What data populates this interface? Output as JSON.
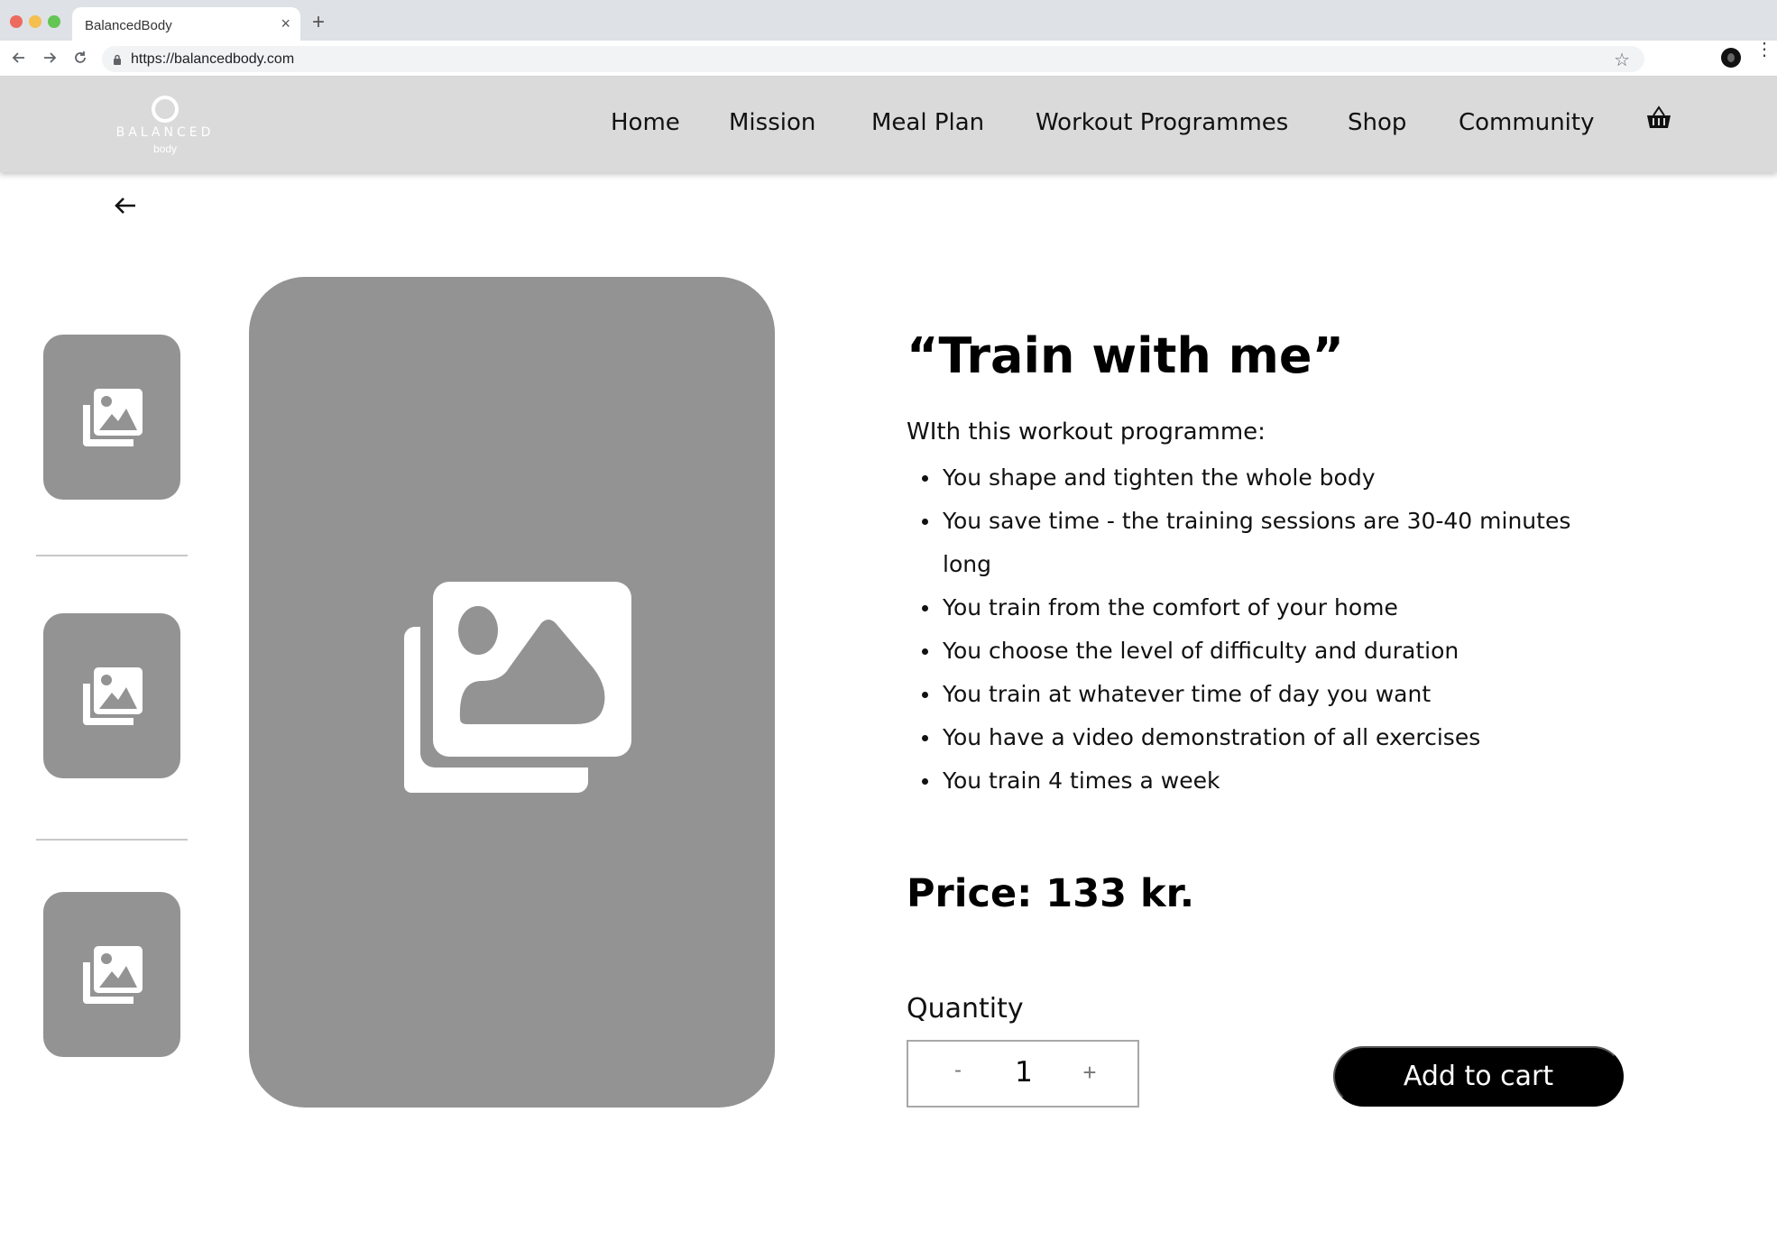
{
  "browser": {
    "tab_title": "BalancedBody",
    "tab_close": "×",
    "new_tab": "+",
    "url": "https://balancedbody.com",
    "bookmark_star": "☆",
    "menu_dots": "⋮"
  },
  "header": {
    "logo_text": "BALANCED",
    "logo_subtext": "body",
    "nav": [
      {
        "label": "Home"
      },
      {
        "label": "Mission"
      },
      {
        "label": "Meal Plan"
      },
      {
        "label": "Workout Programmes"
      },
      {
        "label": "Shop"
      },
      {
        "label": "Community"
      }
    ],
    "cart_icon": "basket-icon"
  },
  "product": {
    "title": "“Train with me”",
    "intro": "WIth this workout programme:",
    "benefits": [
      "You shape and tighten the whole body",
      "You save time - the training sessions are 30-40 minutes long",
      "You train from the comfort of your home",
      "You choose the level of difficulty and duration",
      "You train at whatever time of day you want",
      "You have a video demonstration of all exercises",
      "You train 4 times a week"
    ],
    "price_label": "Price:",
    "price_value": "133 kr.",
    "quantity_label": "Quantity",
    "quantity_minus": "-",
    "quantity_value": "1",
    "quantity_plus": "+",
    "add_to_cart": "Add to cart"
  },
  "gallery": {
    "thumbnail_icon": "image-gallery-icon",
    "main_icon": "image-gallery-icon"
  },
  "colors": {
    "header_bg": "#dadada",
    "placeholder_gray": "#939393",
    "button_bg": "#000000",
    "button_text": "#ffffff"
  }
}
